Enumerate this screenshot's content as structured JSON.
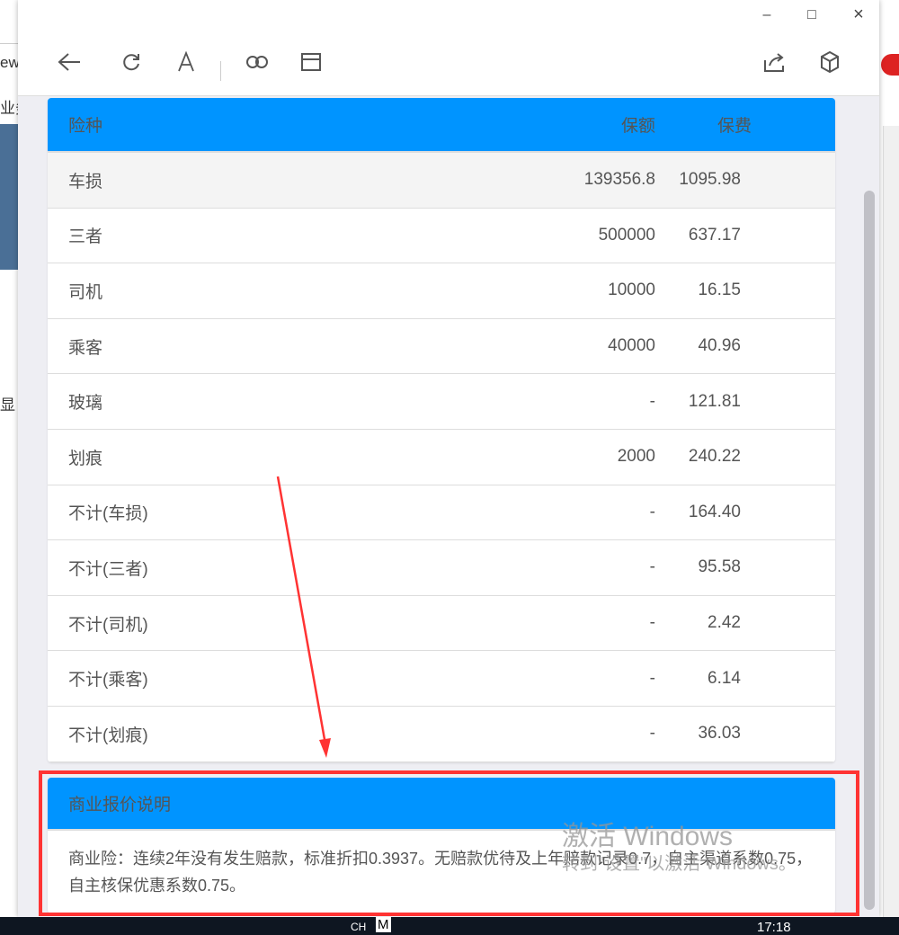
{
  "background": {
    "left_fragments": [
      "ew",
      "业务",
      "显"
    ]
  },
  "window": {
    "controls": {
      "minimize": "–",
      "maximize": "□",
      "close": "×"
    }
  },
  "toolbar": {
    "icons": [
      "back-icon",
      "refresh-icon",
      "font-icon",
      "link-icon",
      "window-icon",
      "share-icon",
      "cube-icon"
    ]
  },
  "table": {
    "headers": [
      "险种",
      "保额",
      "保费"
    ],
    "rows": [
      {
        "type": "车损",
        "amount": "139356.8",
        "premium": "1095.98"
      },
      {
        "type": "三者",
        "amount": "500000",
        "premium": "637.17"
      },
      {
        "type": "司机",
        "amount": "10000",
        "premium": "16.15"
      },
      {
        "type": "乘客",
        "amount": "40000",
        "premium": "40.96"
      },
      {
        "type": "玻璃",
        "amount": "-",
        "premium": "121.81"
      },
      {
        "type": "划痕",
        "amount": "2000",
        "premium": "240.22"
      },
      {
        "type": "不计(车损)",
        "amount": "-",
        "premium": "164.40"
      },
      {
        "type": "不计(三者)",
        "amount": "-",
        "premium": "95.58"
      },
      {
        "type": "不计(司机)",
        "amount": "-",
        "premium": "2.42"
      },
      {
        "type": "不计(乘客)",
        "amount": "-",
        "premium": "6.14"
      },
      {
        "type": "不计(划痕)",
        "amount": "-",
        "premium": "36.03"
      }
    ]
  },
  "description": {
    "title": "商业报价说明",
    "text": "商业险：连续2年没有发生赔款，标准折扣0.3937。无赔款优待及上年赔款记录0.7，自主渠道系数0.75，自主核保优惠系数0.75。"
  },
  "watermark": {
    "line1": "激活 Windows",
    "line2": "转到\"设置\"以激活 Windows。"
  },
  "taskbar": {
    "ime": "CH",
    "ime_mode": "M",
    "time": "17:18"
  },
  "colors": {
    "header_blue": "#0094ff",
    "highlight_red": "#ff3333"
  }
}
